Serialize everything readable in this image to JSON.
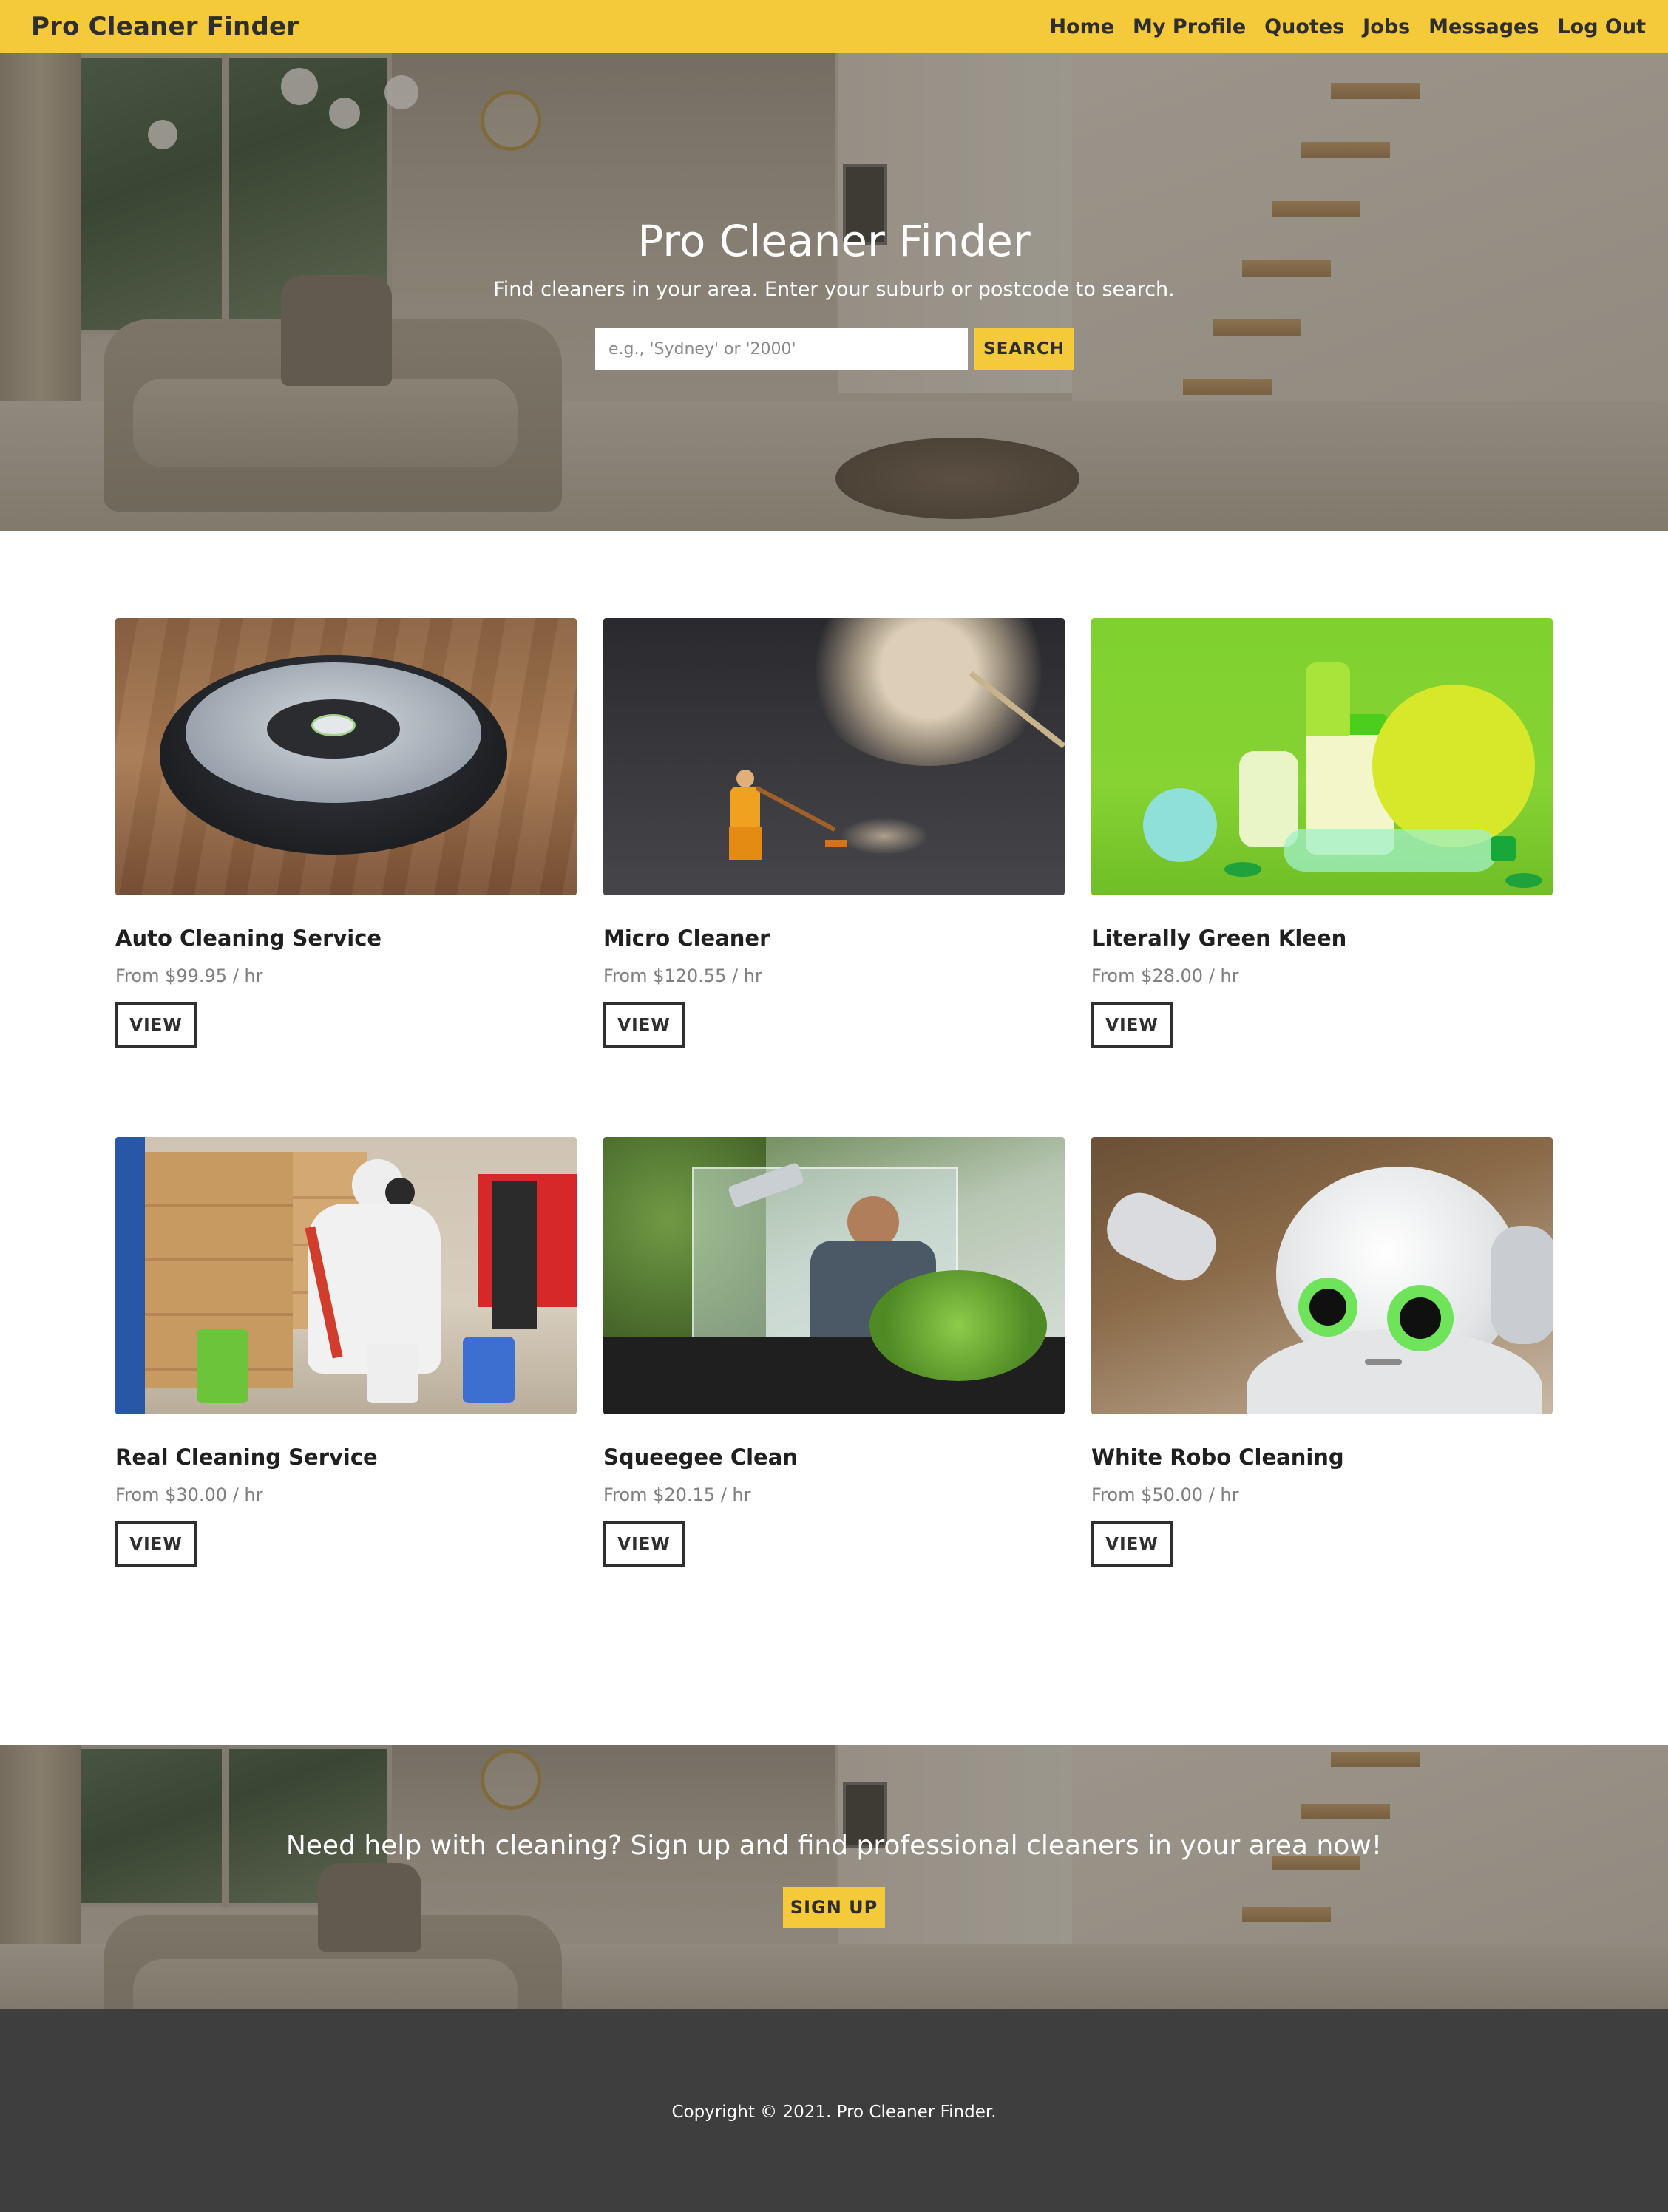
{
  "navbar": {
    "brand": "Pro Cleaner Finder",
    "links": [
      "Home",
      "My Profile",
      "Quotes",
      "Jobs",
      "Messages",
      "Log Out"
    ]
  },
  "hero": {
    "title": "Pro Cleaner Finder",
    "subtitle": "Find cleaners in your area. Enter your suburb or postcode to search.",
    "search_placeholder": "e.g., 'Sydney' or '2000'",
    "search_button": "SEARCH"
  },
  "cleaners": [
    {
      "name": "Auto Cleaning Service",
      "price": "From $99.95 / hr",
      "button": "VIEW",
      "image": "robot-vacuum"
    },
    {
      "name": "Micro Cleaner",
      "price": "From $120.55 / hr",
      "button": "VIEW",
      "image": "miniature-sweeper-dandelion"
    },
    {
      "name": "Literally Green Kleen",
      "price": "From $28.00 / hr",
      "button": "VIEW",
      "image": "green-cleaning-products"
    },
    {
      "name": "Real Cleaning Service",
      "price": "From $30.00 / hr",
      "button": "VIEW",
      "image": "hazmat-cleaner-warehouse"
    },
    {
      "name": "Squeegee Clean",
      "price": "From $20.15 / hr",
      "button": "VIEW",
      "image": "window-squeegee"
    },
    {
      "name": "White Robo Cleaning",
      "price": "From $50.00 / hr",
      "button": "VIEW",
      "image": "white-robot"
    }
  ],
  "cta": {
    "text": "Need help with cleaning? Sign up and find professional cleaners in your area now!",
    "button": "SIGN UP"
  },
  "footer": {
    "copyright": "Copyright © 2021. Pro Cleaner Finder."
  },
  "colors": {
    "accent": "#f4c93a",
    "footer": "#3e3e3e",
    "text_dark": "#2e2e2e",
    "price_grey": "#7f7f7f"
  }
}
